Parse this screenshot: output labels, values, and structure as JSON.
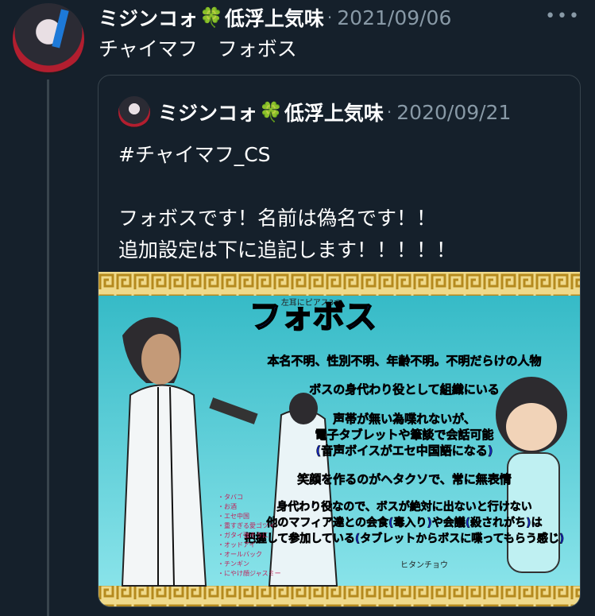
{
  "tweet": {
    "author": "ミジンコォ",
    "clover": "🍀",
    "author_suffix": "低浮上気味",
    "separator": "·",
    "date": "2021/09/06",
    "more": "•••",
    "text": "チャイマフ　フォボス"
  },
  "quoted": {
    "author": "ミジンコォ",
    "clover": "🍀",
    "author_suffix": "低浮上気味",
    "separator": "·",
    "date": "2020/09/21",
    "text": "#チャイマフ_CS\n\nフォボスです！名前は偽名です！！\n追加設定は下に追記します！！！！！"
  },
  "image": {
    "title": "フォボス",
    "ear_note": "左耳にピアス3つ",
    "lines": [
      "本名不明、性別不明、年齢不明。不明だらけの人物",
      "ボスの身代わり役として組織にいる",
      "声帯が無い為喋れないが、",
      "電子タブレットや筆談で会話可能",
      "(音声ボイスがエセ中国語になる)",
      "笑顔を作るのがヘタクソで、常に無表情",
      "身代わり役なので、ボスが絶対に出ないと行けない",
      "他のマフィア達との会食(毒入り)や会議(殺されがち)は",
      "把握して参加している(タブレットからボスに喋ってもらう感じ)"
    ],
    "side_notes": [
      "・タバコ",
      "・お酒",
      "・エセ中国",
      "・重すぎる愛ゴツイ",
      "・ガタイ強そうに",
      "・オッドアイ",
      "・オールバック",
      "・チンギン",
      "・にやけ顔ジャスミー"
    ],
    "sig": "ヒタンチョウ",
    "colors": {
      "bg_top": "#2fb7c4",
      "bg_bottom": "#8fe6ec",
      "gold": "#d8b24a",
      "title_fill": "#1234c8",
      "text_fill": "#1428c8"
    }
  }
}
